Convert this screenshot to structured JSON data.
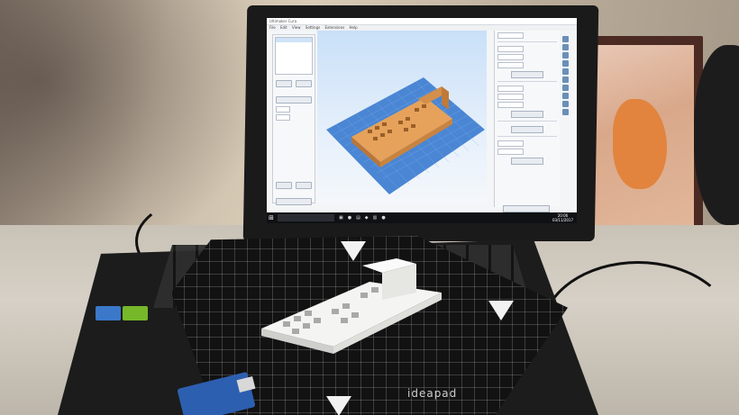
{
  "screen": {
    "window_title": "Ultimaker Cura",
    "menu": [
      "File",
      "Edit",
      "View",
      "Settings",
      "Extensions",
      "Help"
    ],
    "taskbar": {
      "search_placeholder": "",
      "time": "20:06",
      "date": "03/11/2017"
    }
  },
  "device": {
    "mat_brand": "ideapad"
  },
  "colors": {
    "model_orange": "#e6a25a",
    "build_plate_blue": "#4a86d4",
    "printed_part_white": "#f4f4f2"
  }
}
